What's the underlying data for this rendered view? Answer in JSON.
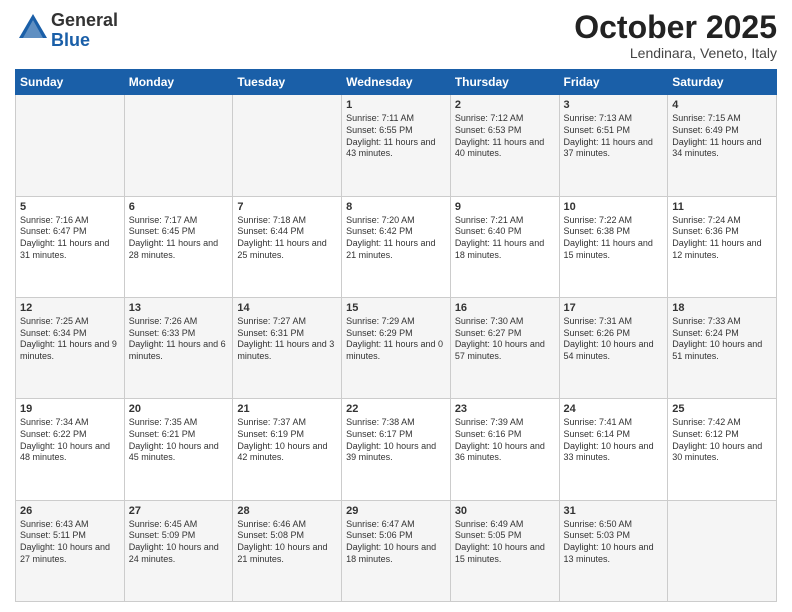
{
  "logo": {
    "general": "General",
    "blue": "Blue"
  },
  "header": {
    "month": "October 2025",
    "location": "Lendinara, Veneto, Italy"
  },
  "days_of_week": [
    "Sunday",
    "Monday",
    "Tuesday",
    "Wednesday",
    "Thursday",
    "Friday",
    "Saturday"
  ],
  "weeks": [
    [
      {
        "day": "",
        "info": ""
      },
      {
        "day": "",
        "info": ""
      },
      {
        "day": "",
        "info": ""
      },
      {
        "day": "1",
        "info": "Sunrise: 7:11 AM\nSunset: 6:55 PM\nDaylight: 11 hours and 43 minutes."
      },
      {
        "day": "2",
        "info": "Sunrise: 7:12 AM\nSunset: 6:53 PM\nDaylight: 11 hours and 40 minutes."
      },
      {
        "day": "3",
        "info": "Sunrise: 7:13 AM\nSunset: 6:51 PM\nDaylight: 11 hours and 37 minutes."
      },
      {
        "day": "4",
        "info": "Sunrise: 7:15 AM\nSunset: 6:49 PM\nDaylight: 11 hours and 34 minutes."
      }
    ],
    [
      {
        "day": "5",
        "info": "Sunrise: 7:16 AM\nSunset: 6:47 PM\nDaylight: 11 hours and 31 minutes."
      },
      {
        "day": "6",
        "info": "Sunrise: 7:17 AM\nSunset: 6:45 PM\nDaylight: 11 hours and 28 minutes."
      },
      {
        "day": "7",
        "info": "Sunrise: 7:18 AM\nSunset: 6:44 PM\nDaylight: 11 hours and 25 minutes."
      },
      {
        "day": "8",
        "info": "Sunrise: 7:20 AM\nSunset: 6:42 PM\nDaylight: 11 hours and 21 minutes."
      },
      {
        "day": "9",
        "info": "Sunrise: 7:21 AM\nSunset: 6:40 PM\nDaylight: 11 hours and 18 minutes."
      },
      {
        "day": "10",
        "info": "Sunrise: 7:22 AM\nSunset: 6:38 PM\nDaylight: 11 hours and 15 minutes."
      },
      {
        "day": "11",
        "info": "Sunrise: 7:24 AM\nSunset: 6:36 PM\nDaylight: 11 hours and 12 minutes."
      }
    ],
    [
      {
        "day": "12",
        "info": "Sunrise: 7:25 AM\nSunset: 6:34 PM\nDaylight: 11 hours and 9 minutes."
      },
      {
        "day": "13",
        "info": "Sunrise: 7:26 AM\nSunset: 6:33 PM\nDaylight: 11 hours and 6 minutes."
      },
      {
        "day": "14",
        "info": "Sunrise: 7:27 AM\nSunset: 6:31 PM\nDaylight: 11 hours and 3 minutes."
      },
      {
        "day": "15",
        "info": "Sunrise: 7:29 AM\nSunset: 6:29 PM\nDaylight: 11 hours and 0 minutes."
      },
      {
        "day": "16",
        "info": "Sunrise: 7:30 AM\nSunset: 6:27 PM\nDaylight: 10 hours and 57 minutes."
      },
      {
        "day": "17",
        "info": "Sunrise: 7:31 AM\nSunset: 6:26 PM\nDaylight: 10 hours and 54 minutes."
      },
      {
        "day": "18",
        "info": "Sunrise: 7:33 AM\nSunset: 6:24 PM\nDaylight: 10 hours and 51 minutes."
      }
    ],
    [
      {
        "day": "19",
        "info": "Sunrise: 7:34 AM\nSunset: 6:22 PM\nDaylight: 10 hours and 48 minutes."
      },
      {
        "day": "20",
        "info": "Sunrise: 7:35 AM\nSunset: 6:21 PM\nDaylight: 10 hours and 45 minutes."
      },
      {
        "day": "21",
        "info": "Sunrise: 7:37 AM\nSunset: 6:19 PM\nDaylight: 10 hours and 42 minutes."
      },
      {
        "day": "22",
        "info": "Sunrise: 7:38 AM\nSunset: 6:17 PM\nDaylight: 10 hours and 39 minutes."
      },
      {
        "day": "23",
        "info": "Sunrise: 7:39 AM\nSunset: 6:16 PM\nDaylight: 10 hours and 36 minutes."
      },
      {
        "day": "24",
        "info": "Sunrise: 7:41 AM\nSunset: 6:14 PM\nDaylight: 10 hours and 33 minutes."
      },
      {
        "day": "25",
        "info": "Sunrise: 7:42 AM\nSunset: 6:12 PM\nDaylight: 10 hours and 30 minutes."
      }
    ],
    [
      {
        "day": "26",
        "info": "Sunrise: 6:43 AM\nSunset: 5:11 PM\nDaylight: 10 hours and 27 minutes."
      },
      {
        "day": "27",
        "info": "Sunrise: 6:45 AM\nSunset: 5:09 PM\nDaylight: 10 hours and 24 minutes."
      },
      {
        "day": "28",
        "info": "Sunrise: 6:46 AM\nSunset: 5:08 PM\nDaylight: 10 hours and 21 minutes."
      },
      {
        "day": "29",
        "info": "Sunrise: 6:47 AM\nSunset: 5:06 PM\nDaylight: 10 hours and 18 minutes."
      },
      {
        "day": "30",
        "info": "Sunrise: 6:49 AM\nSunset: 5:05 PM\nDaylight: 10 hours and 15 minutes."
      },
      {
        "day": "31",
        "info": "Sunrise: 6:50 AM\nSunset: 5:03 PM\nDaylight: 10 hours and 13 minutes."
      },
      {
        "day": "",
        "info": ""
      }
    ]
  ]
}
